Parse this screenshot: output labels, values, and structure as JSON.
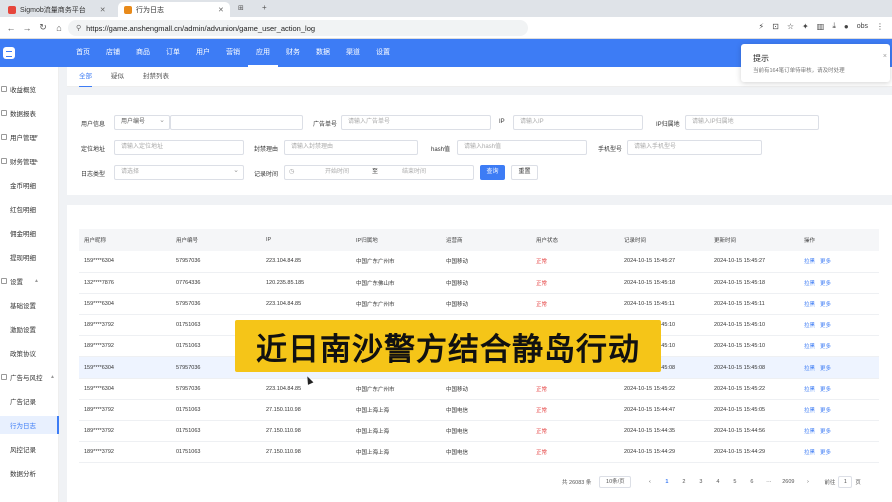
{
  "browser": {
    "tabs": [
      {
        "title": "Sigmob流量商务平台",
        "favicon_color": "#e6463c"
      },
      {
        "title": "行为日志",
        "favicon_color": "#e88a1a"
      }
    ],
    "url": "https://game.anshengmall.cn/admin/advunion/game_user_action_log",
    "profile": "obs"
  },
  "header": {
    "nav": [
      "首页",
      "店铺",
      "商品",
      "订单",
      "用户",
      "营销",
      "应用",
      "财务",
      "数据",
      "渠道",
      "设置"
    ],
    "active_nav": "应用",
    "brand_color": "#3d7cf5"
  },
  "sidebar": {
    "items": [
      {
        "label": "收益概览",
        "type": "item"
      },
      {
        "label": "数据报表",
        "type": "item"
      },
      {
        "label": "用户管理",
        "type": "group"
      },
      {
        "label": "财务管理",
        "type": "group"
      },
      {
        "label": "金币明细",
        "type": "sub"
      },
      {
        "label": "红包明细",
        "type": "sub"
      },
      {
        "label": "佣金明细",
        "type": "sub"
      },
      {
        "label": "提现明细",
        "type": "sub"
      },
      {
        "label": "设置",
        "type": "group"
      },
      {
        "label": "基础设置",
        "type": "sub"
      },
      {
        "label": "激励设置",
        "type": "sub"
      },
      {
        "label": "政策协议",
        "type": "sub"
      },
      {
        "label": "广告与风控",
        "type": "group"
      },
      {
        "label": "广告记录",
        "type": "sub"
      },
      {
        "label": "行为日志",
        "type": "sub",
        "active": true
      },
      {
        "label": "风控记录",
        "type": "sub"
      },
      {
        "label": "数据分析",
        "type": "sub"
      }
    ]
  },
  "subtabs": [
    "全部",
    "疑似",
    "封禁列表"
  ],
  "filters": {
    "user_info_label": "用户信息",
    "user_info_select": "用户编号",
    "ad_order_label": "广告单号",
    "ad_order_placeholder": "请输入广告单号",
    "ip_label": "IP",
    "ip_placeholder": "请输入IP",
    "ip_region_label": "IP归属地",
    "ip_region_placeholder": "请输入IP归属地",
    "location_label": "定位地址",
    "location_placeholder": "请输入定位地址",
    "ban_reason_label": "封禁理由",
    "ban_reason_placeholder": "请输入封禁理由",
    "hash_label": "hash值",
    "hash_placeholder": "请输入hash值",
    "phone_model_label": "手机型号",
    "phone_model_placeholder": "请输入手机型号",
    "log_type_label": "日志类型",
    "log_type_placeholder": "请选择",
    "record_time_label": "记录时间",
    "start_placeholder": "开始时间",
    "range_sep": "至",
    "end_placeholder": "结束时间",
    "search_btn": "查询",
    "reset_btn": "重置"
  },
  "table": {
    "columns": [
      "用户昵称",
      "用户编号",
      "IP",
      "IP归属地",
      "运营商",
      "用户状态",
      "记录时间",
      "更新时间",
      "操作"
    ],
    "rows": [
      [
        "159****6304",
        "57957036",
        "223.104.84.85",
        "中国广东广州市",
        "中国移动",
        "正常",
        "2024-10-15 15:45:27",
        "2024-10-15 15:45:27"
      ],
      [
        "132****7876",
        "07764336",
        "120.235.85.185",
        "中国广东佛山市",
        "中国移动",
        "正常",
        "2024-10-15 15:45:18",
        "2024-10-15 15:45:18"
      ],
      [
        "159****6304",
        "57957036",
        "223.104.84.85",
        "中国广东广州市",
        "中国移动",
        "正常",
        "2024-10-15 15:45:11",
        "2024-10-15 15:45:11"
      ],
      [
        "189****3792",
        "01751063",
        "",
        "",
        "",
        "正常",
        "2024-10-15 15:45:10",
        "2024-10-15 15:45:10"
      ],
      [
        "189****3792",
        "01751063",
        "",
        "",
        "",
        "正常",
        "2024-10-15 15:45:10",
        "2024-10-15 15:45:10"
      ],
      [
        "159****6304",
        "57957036",
        "",
        "",
        "",
        "正常",
        "2024-10-15 15:45:08",
        "2024-10-15 15:45:08"
      ],
      [
        "159****6304",
        "57957036",
        "223.104.84.85",
        "中国广东广州市",
        "中国移动",
        "正常",
        "2024-10-15 15:45:22",
        "2024-10-15 15:45:22"
      ],
      [
        "189****3792",
        "01751063",
        "27.150.110.98",
        "中国上海上海",
        "中国电信",
        "正常",
        "2024-10-15 15:44:47",
        "2024-10-15 15:45:05"
      ],
      [
        "189****3792",
        "01751063",
        "27.150.110.98",
        "中国上海上海",
        "中国电信",
        "正常",
        "2024-10-15 15:44:35",
        "2024-10-15 15:44:56"
      ],
      [
        "189****3792",
        "01751063",
        "27.150.110.98",
        "中国上海上海",
        "中国电信",
        "正常",
        "2024-10-15 15:44:29",
        "2024-10-15 15:44:29"
      ]
    ],
    "actions": [
      "拉黑",
      "更多"
    ],
    "highlight_row": 5
  },
  "pagination": {
    "total": "共 26083 条",
    "page_size": "10条/页",
    "pages": [
      "‹",
      "1",
      "2",
      "3",
      "4",
      "5",
      "6",
      "···",
      "2609",
      "›"
    ],
    "current": "1",
    "goto_label": "前往",
    "goto_value": "1",
    "page_suffix": "页"
  },
  "toast": {
    "title": "提示",
    "message": "当前有164笔订单待审核，请及时处理",
    "close": "×"
  },
  "overlay_caption": "近日南沙警方结合静岛行动"
}
